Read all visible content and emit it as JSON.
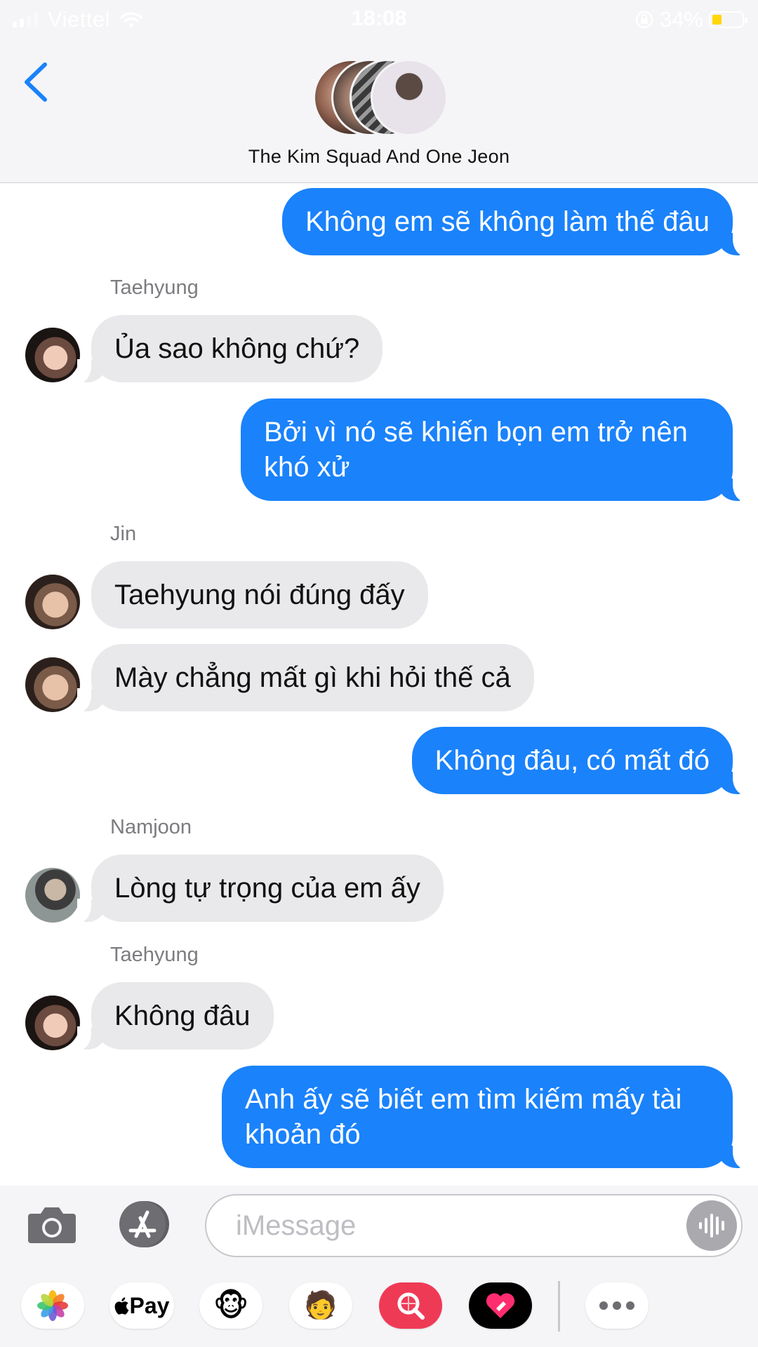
{
  "status_bar": {
    "carrier": "Viettel",
    "time": "18:08",
    "battery_percent": "34%",
    "battery_level": 0.34,
    "icons": [
      "signal-icon",
      "wifi-icon",
      "rotation-lock-icon",
      "battery-icon"
    ]
  },
  "header": {
    "back_icon": "chevron-left-icon",
    "group_name": "The Kim Squad And One Jeon"
  },
  "messages": {
    "m1": "Không em sẽ không làm thế đâu",
    "s1": "Taehyung",
    "m2": "Ủa sao không chứ?",
    "m3": "Bởi vì nó sẽ khiến bọn em trở nên khó xử",
    "s2": "Jin",
    "m4": "Taehyung nói đúng đấy",
    "m5": "Mày chẳng mất gì khi hỏi thế cả",
    "m6": "Không đâu, có mất đó",
    "s3": "Namjoon",
    "m7": "Lòng tự trọng của em ấy",
    "s4": "Taehyung",
    "m8": "Không đâu",
    "m9": "Anh ấy sẽ biết em tìm kiếm mấy tài khoản đó"
  },
  "composer": {
    "placeholder": "iMessage",
    "camera_icon": "camera-icon",
    "appstore_icon": "app-store-icon",
    "voice_icon": "waveform-icon"
  },
  "app_drawer": {
    "pay_label": "Pay",
    "apps": [
      "photos-icon",
      "apple-pay-icon",
      "animoji-icon",
      "memoji-icon",
      "image-search-icon",
      "digital-touch-icon",
      "more-icon"
    ]
  },
  "colors": {
    "outgoing_bubble": "#1a82fb",
    "incoming_bubble": "#e9e9eb",
    "accent": "#1a82fb"
  }
}
